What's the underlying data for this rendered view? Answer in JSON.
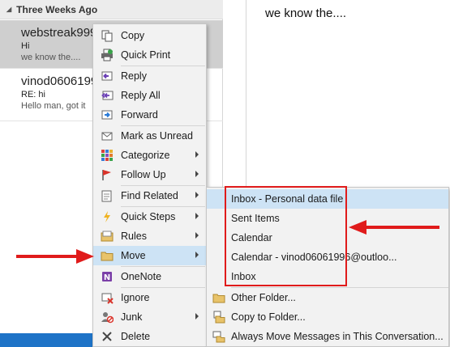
{
  "mail_list": {
    "group_header": "Three Weeks Ago",
    "items": [
      {
        "sender": "webstreak999",
        "subject": "Hi",
        "preview": "we know the...."
      },
      {
        "sender": "vinod0606199",
        "subject": "RE: hi",
        "preview": "Hello man, got it"
      }
    ]
  },
  "reading_pane": {
    "body": "we know the...."
  },
  "context_menu": {
    "items": [
      {
        "label": "Copy",
        "icon": "copy-icon"
      },
      {
        "label": "Quick Print",
        "icon": "quick-print-icon"
      },
      {
        "label": "Reply",
        "icon": "reply-icon"
      },
      {
        "label": "Reply All",
        "icon": "reply-all-icon"
      },
      {
        "label": "Forward",
        "icon": "forward-icon"
      },
      {
        "label": "Mark as Unread",
        "icon": "mark-unread-icon"
      },
      {
        "label": "Categorize",
        "icon": "categorize-icon"
      },
      {
        "label": "Follow Up",
        "icon": "follow-up-flag-icon"
      },
      {
        "label": "Find Related",
        "icon": "find-related-icon"
      },
      {
        "label": "Quick Steps",
        "icon": "quick-steps-icon"
      },
      {
        "label": "Rules",
        "icon": "rules-icon"
      },
      {
        "label": "Move",
        "icon": "move-folder-icon"
      },
      {
        "label": "OneNote",
        "icon": "onenote-icon"
      },
      {
        "label": "Ignore",
        "icon": "ignore-icon"
      },
      {
        "label": "Junk",
        "icon": "junk-icon"
      },
      {
        "label": "Delete",
        "icon": "delete-icon"
      }
    ]
  },
  "move_submenu": {
    "items": [
      {
        "label": "Inbox - Personal data file"
      },
      {
        "label": "Sent Items"
      },
      {
        "label": "Calendar"
      },
      {
        "label": "Calendar - vinod06061996@outloo..."
      },
      {
        "label": "Inbox"
      },
      {
        "label": "Other Folder...",
        "icon": "other-folder-icon"
      },
      {
        "label": "Copy to Folder...",
        "icon": "copy-to-folder-icon"
      },
      {
        "label": "Always Move Messages in This Conversation...",
        "icon": "always-move-icon"
      }
    ]
  },
  "colors": {
    "highlight": "#cde3f5",
    "annotation_red": "#e01b1b",
    "menu_bg": "#f2f2f2"
  }
}
